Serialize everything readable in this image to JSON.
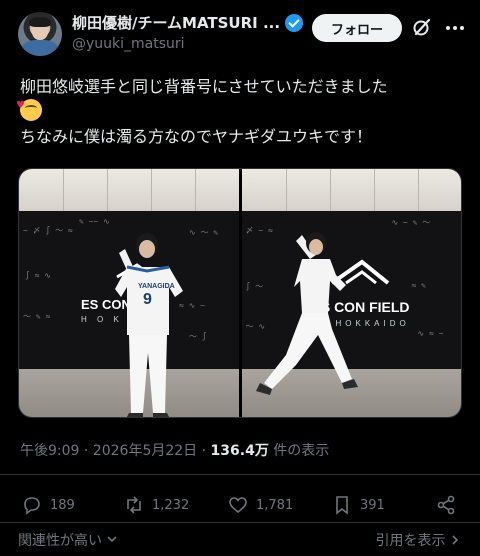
{
  "header": {
    "display_name": "柳田優樹/チームMATSURI ...",
    "handle": "@yuuki_matsuri",
    "follow_label": "フォロー"
  },
  "tweet": {
    "line1": "柳田悠岐選手と同じ背番号にさせていただきました",
    "line3": "ちなみに僕は濁る方なのでヤナギダユウキです！"
  },
  "media": {
    "photo1": {
      "jersey_name": "YANAGIDA",
      "jersey_number": "9",
      "logo_text": "ES CON",
      "logo_sub": "H O K"
    },
    "photo2": {
      "logo_text": "ES CON FIELD",
      "logo_sub": "HOKKAIDO"
    }
  },
  "meta": {
    "time": "午後9:09",
    "separator": "·",
    "date": "2026年5月22日",
    "views": "136.4万",
    "views_suffix": "件の表示"
  },
  "actions": {
    "replies": "189",
    "reposts": "1,232",
    "likes": "1,781",
    "bookmarks": "391"
  },
  "footer": {
    "sort_label": "関連性が高い",
    "quotes_label": "引用を表示"
  },
  "colors": {
    "background": "#000000",
    "verified": "#1d9bf0",
    "muted_text": "#71767b",
    "follow_button_bg": "#eff3f4"
  },
  "icons": [
    "grok-icon",
    "more-icon",
    "verified-icon",
    "reply-icon",
    "repost-icon",
    "like-icon",
    "bookmark-icon",
    "share-icon",
    "chevron-down-icon",
    "chevron-right-icon"
  ]
}
